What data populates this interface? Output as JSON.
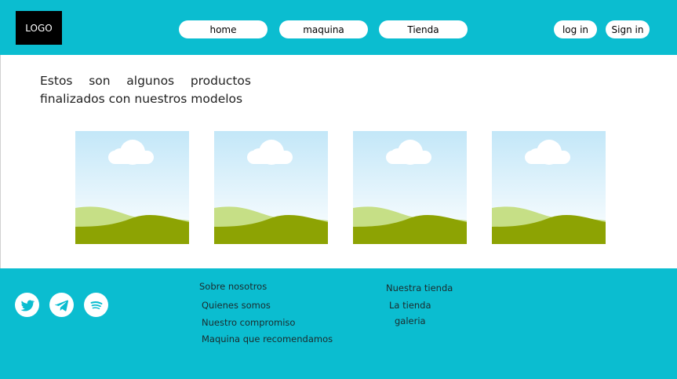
{
  "header": {
    "logo": "LOGO",
    "nav": [
      {
        "label": "home"
      },
      {
        "label": "maquina"
      },
      {
        "label": "Tienda"
      }
    ],
    "login_label": "log in",
    "signin_label": "Sign in"
  },
  "main": {
    "intro_text": "Estos son algunos productos finalizados con nuestros modelos",
    "gallery_count": 4
  },
  "footer": {
    "social": [
      {
        "icon": "twitter-icon"
      },
      {
        "icon": "telegram-icon"
      },
      {
        "icon": "spotify-icon"
      }
    ],
    "sobre": {
      "heading": "Sobre nosotros",
      "links": [
        "Quienes somos",
        "Nuestro compromiso",
        "Maquina que recomendamos"
      ]
    },
    "tienda": {
      "heading": "Nuestra tienda",
      "links": [
        "La tienda",
        "galeria"
      ]
    }
  },
  "colors": {
    "accent": "#0bbdd0",
    "sky_top": "#c3e7f8",
    "grass_light": "#c6df86",
    "grass_dark": "#8da303"
  }
}
